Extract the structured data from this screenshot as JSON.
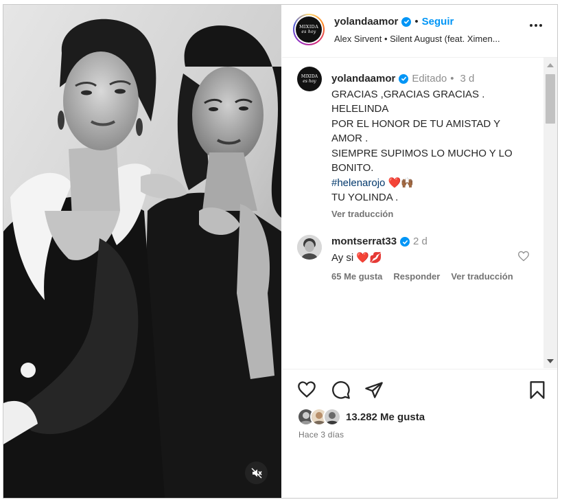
{
  "header": {
    "avatar_text_top": "MIXIDA",
    "avatar_text_sub": "es hoy",
    "username": "yolandaamor",
    "separator": "•",
    "follow_label": "Seguir",
    "audio": "Alex Sirvent • Silent August (feat. Ximen..."
  },
  "caption": {
    "username": "yolandaamor",
    "edited": "Editado",
    "separator": "•",
    "age": "3 d",
    "lines": [
      "GRACIAS ,GRACIAS GRACIAS .",
      "HELELINDA",
      "POR EL HONOR DE TU AMISTAD Y",
      "AMOR .",
      "SIEMPRE SUPIMOS LO MUCHO Y LO",
      "BONITO."
    ],
    "hashtag": "#helenarojo",
    "hashtag_emojis": "❤️🙌🏾",
    "signoff": "TU YOLINDA .",
    "translate": "Ver traducción"
  },
  "reply": {
    "username": "montserrat33",
    "age": "2 d",
    "text": "Ay si",
    "emojis": "❤️💋",
    "likes": "65 Me gusta",
    "reply_label": "Responder",
    "translate": "Ver traducción"
  },
  "footer": {
    "likes": "13.282 Me gusta",
    "posted": "Hace 3 días"
  },
  "icons": {
    "like": "heart-icon",
    "comment": "comment-icon",
    "share": "send-icon",
    "save": "bookmark-icon",
    "mute": "muted-speaker-icon",
    "more": "more-dots-icon",
    "verified": "verified-badge-icon"
  },
  "colors": {
    "accent": "#0095f6",
    "text": "#262626",
    "muted": "#737373",
    "hashtag": "#00376b",
    "heart_red": "#e0245e"
  }
}
